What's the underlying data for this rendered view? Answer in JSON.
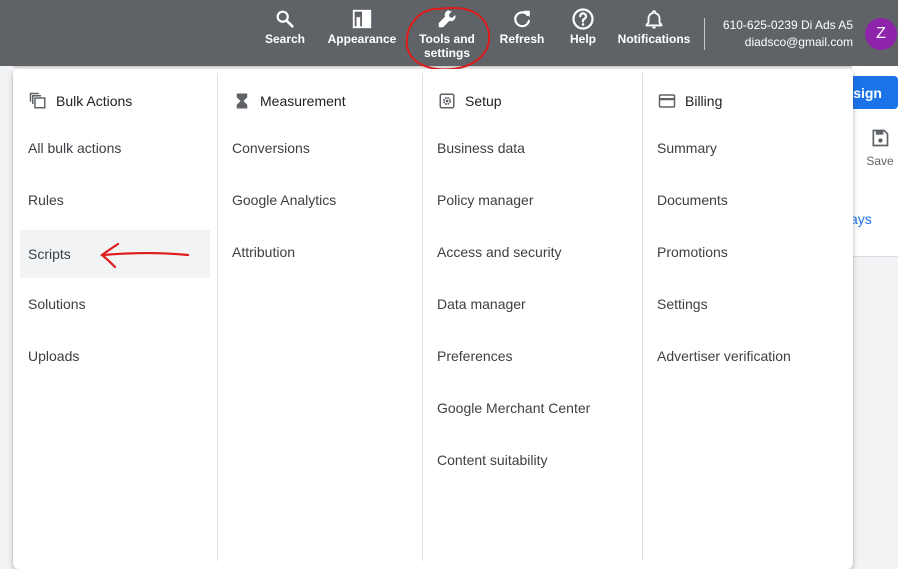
{
  "topbar": {
    "buttons": [
      {
        "label": "Search",
        "icon": "search-icon"
      },
      {
        "label": "Appearance",
        "icon": "appearance-icon"
      },
      {
        "label": "Tools and\nsettings",
        "icon": "wrench-icon"
      },
      {
        "label": "Refresh",
        "icon": "refresh-icon"
      },
      {
        "label": "Help",
        "icon": "help-icon"
      },
      {
        "label": "Notifications",
        "icon": "bell-icon"
      }
    ],
    "account_line": "610-625-0239 Di Ads A5",
    "account_email": "diadsco@gmail.com",
    "avatar_letter": "Z"
  },
  "background": {
    "design_label": "esign",
    "save_label": "Save",
    "days_label": "ays"
  },
  "menu": {
    "columns": [
      {
        "heading": "Bulk Actions",
        "icon": "bulk-actions-icon",
        "items": [
          "All bulk actions",
          "Rules",
          "Scripts",
          "Solutions",
          "Uploads"
        ]
      },
      {
        "heading": "Measurement",
        "icon": "hourglass-icon",
        "items": [
          "Conversions",
          "Google Analytics",
          "Attribution"
        ]
      },
      {
        "heading": "Setup",
        "icon": "setup-gear-icon",
        "items": [
          "Business data",
          "Policy manager",
          "Access and security",
          "Data manager",
          "Preferences",
          "Google Merchant Center",
          "Content suitability"
        ]
      },
      {
        "heading": "Billing",
        "icon": "credit-card-icon",
        "items": [
          "Summary",
          "Documents",
          "Promotions",
          "Settings",
          "Advertiser verification"
        ]
      }
    ]
  },
  "colors": {
    "topbar": "#5f6368",
    "annotation": "#e01b1b",
    "highlight": "#f1f3f4",
    "accent": "#1a73e8",
    "avatar": "#8e24aa"
  }
}
